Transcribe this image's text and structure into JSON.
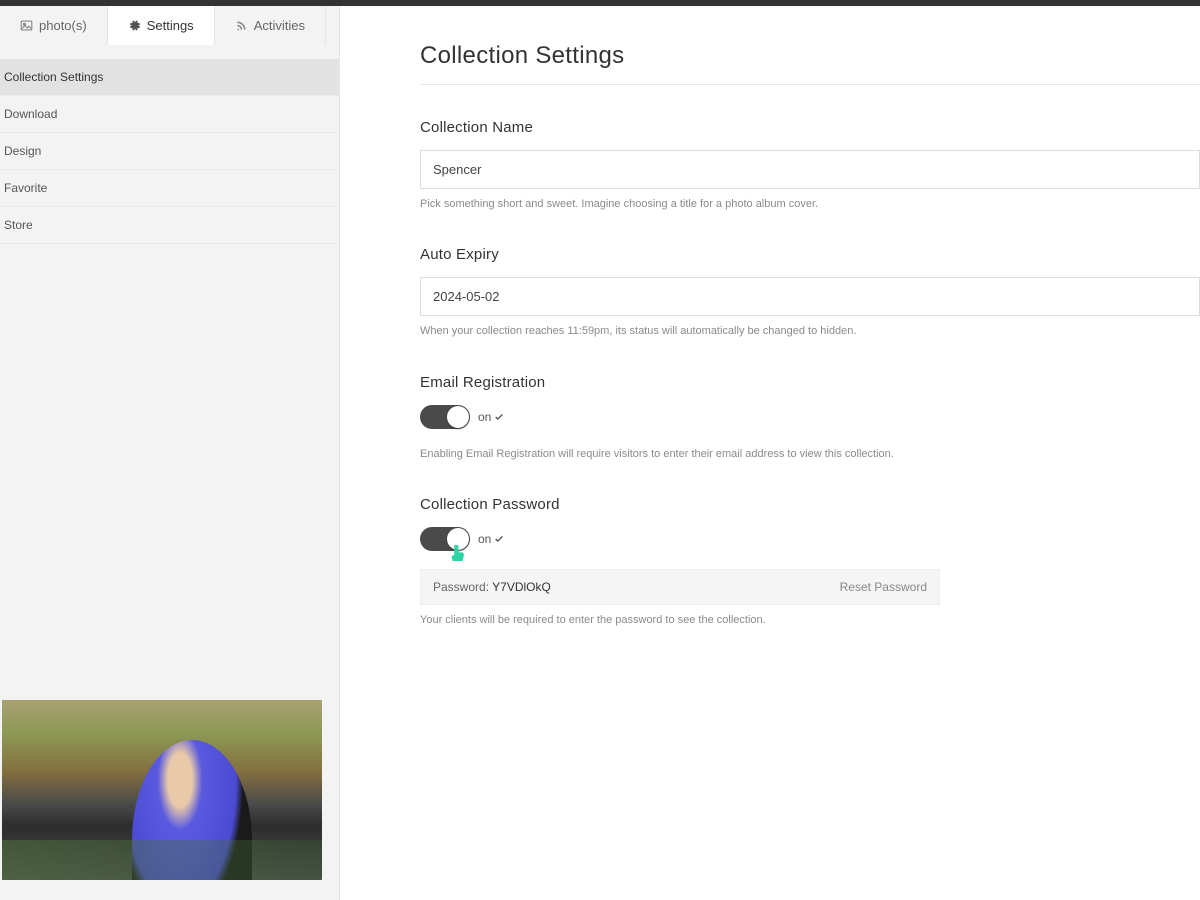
{
  "tabs": {
    "photos": "photo(s)",
    "settings": "Settings",
    "activities": "Activities"
  },
  "sidebar": {
    "items": [
      "Collection Settings",
      "Download",
      "Design",
      "Favorite",
      "Store"
    ]
  },
  "page": {
    "title": "Collection Settings"
  },
  "collection_name": {
    "label": "Collection Name",
    "value": "Spencer",
    "help": "Pick something short and sweet. Imagine choosing a title for a photo album cover."
  },
  "auto_expiry": {
    "label": "Auto Expiry",
    "value": "2024-05-02",
    "help": "When your collection reaches 11:59pm, its status will automatically be changed to hidden."
  },
  "email_registration": {
    "label": "Email Registration",
    "state": "on",
    "help": "Enabling Email Registration will require visitors to enter their email address to view this collection."
  },
  "collection_password": {
    "label": "Collection Password",
    "state": "on",
    "password_label": "Password: ",
    "password_value": "Y7VDlOkQ",
    "reset_label": "Reset Password",
    "help": "Your clients will be required to enter the password to see the collection."
  }
}
